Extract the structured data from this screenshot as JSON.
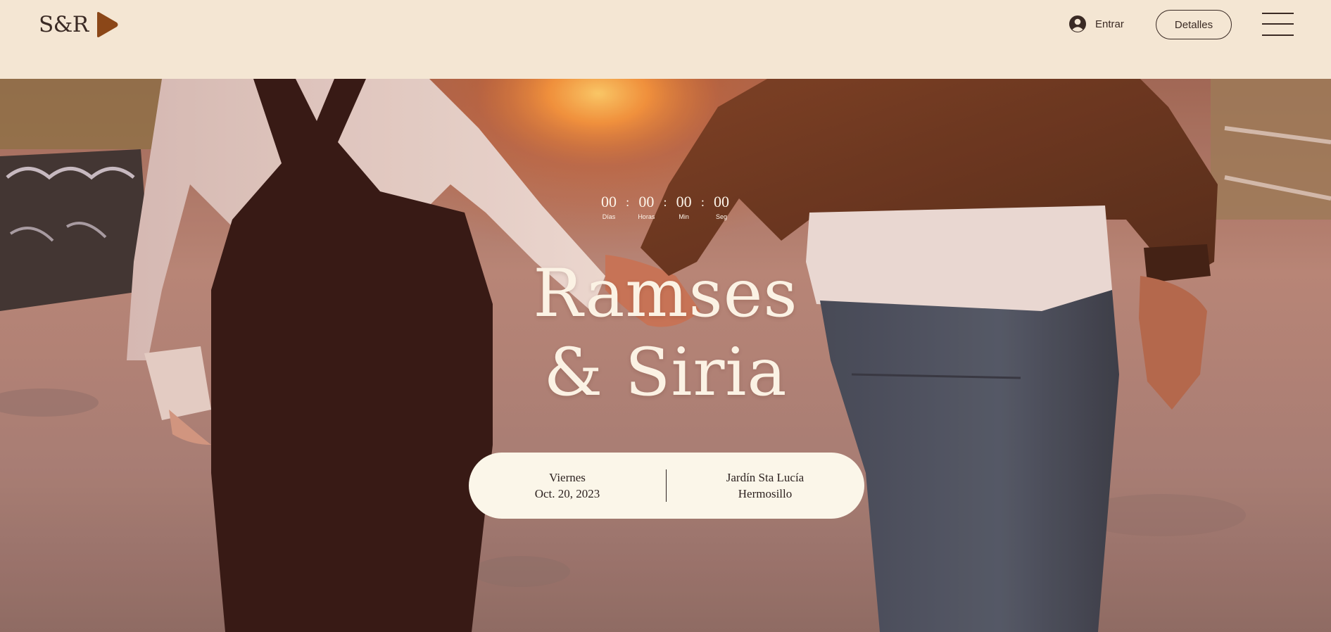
{
  "header": {
    "logo_text": "S&R",
    "login_label": "Entrar",
    "details_label": "Detalles"
  },
  "countdown": {
    "days": "00",
    "hours": "00",
    "minutes": "00",
    "seconds": "00",
    "days_label": "Días",
    "hours_label": "Horas",
    "minutes_label": "Min",
    "seconds_label": "Seg",
    "separator": ":"
  },
  "hero": {
    "title_line1": "Ramses",
    "title_line2": "& Siria"
  },
  "info": {
    "day": "Viernes",
    "date": "Oct. 20, 2023",
    "venue": "Jardín Sta Lucía",
    "city": "Hermosillo"
  },
  "icons": {
    "logo_mark": "play-triangle-icon",
    "login": "user-avatar-icon",
    "menu": "hamburger-menu-icon"
  },
  "colors": {
    "header_bg": "#f4e6d3",
    "ink": "#3a2a24",
    "accent": "#8b4718",
    "pill_bg": "#fbf6e9"
  }
}
